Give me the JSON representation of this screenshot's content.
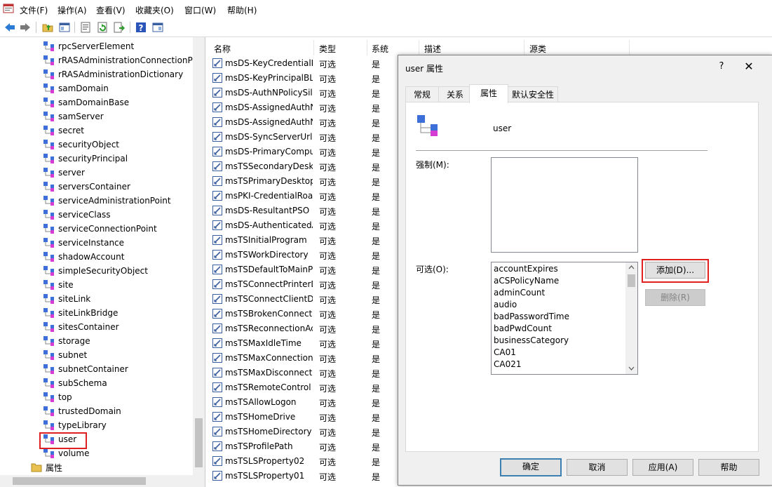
{
  "menu": [
    "文件(F)",
    "操作(A)",
    "查看(V)",
    "收藏夹(O)",
    "窗口(W)",
    "帮助(H)"
  ],
  "toolbar": {
    "icons": [
      "back-arrow-icon",
      "forward-arrow-icon",
      "up-folder-icon",
      "show-hide-tree-icon",
      "properties-icon",
      "refresh-icon",
      "export-list-icon",
      "help-icon",
      "console-icon"
    ]
  },
  "tree": {
    "items": [
      "rpcServerElement",
      "rRASAdministrationConnectionPc",
      "rRASAdministrationDictionary",
      "samDomain",
      "samDomainBase",
      "samServer",
      "secret",
      "securityObject",
      "securityPrincipal",
      "server",
      "serversContainer",
      "serviceAdministrationPoint",
      "serviceClass",
      "serviceConnectionPoint",
      "serviceInstance",
      "shadowAccount",
      "simpleSecurityObject",
      "site",
      "siteLink",
      "siteLinkBridge",
      "sitesContainer",
      "storage",
      "subnet",
      "subnetContainer",
      "subSchema",
      "top",
      "trustedDomain",
      "typeLibrary",
      "user",
      "volume"
    ],
    "selected_index": 28,
    "folder_label": "属性"
  },
  "list": {
    "columns": [
      "名称",
      "类型",
      "系统",
      "描述",
      "源类"
    ],
    "rows": [
      {
        "name": "msDS-KeyCredentialLink",
        "type": "可选",
        "sys": "是"
      },
      {
        "name": "msDS-KeyPrincipalBL",
        "type": "可选",
        "sys": "是"
      },
      {
        "name": "msDS-AuthNPolicySiloMembersBL",
        "type": "可选",
        "sys": "是"
      },
      {
        "name": "msDS-AssignedAuthNPolicySilo",
        "type": "可选",
        "sys": "是"
      },
      {
        "name": "msDS-AssignedAuthNPolicy",
        "type": "可选",
        "sys": "是"
      },
      {
        "name": "msDS-SyncServerUrl",
        "type": "可选",
        "sys": "是"
      },
      {
        "name": "msDS-PrimaryComputer",
        "type": "可选",
        "sys": "是"
      },
      {
        "name": "msTSSecondaryDesktops",
        "type": "可选",
        "sys": "是"
      },
      {
        "name": "msTSPrimaryDesktop",
        "type": "可选",
        "sys": "是"
      },
      {
        "name": "msPKI-CredentialRoamingTokens",
        "type": "可选",
        "sys": "是"
      },
      {
        "name": "msDS-ResultantPSO",
        "type": "可选",
        "sys": "是"
      },
      {
        "name": "msDS-AuthenticatedAtDC",
        "type": "可选",
        "sys": "是"
      },
      {
        "name": "msTSInitialProgram",
        "type": "可选",
        "sys": "是"
      },
      {
        "name": "msTSWorkDirectory",
        "type": "可选",
        "sys": "是"
      },
      {
        "name": "msTSDefaultToMainPrinter",
        "type": "可选",
        "sys": "是"
      },
      {
        "name": "msTSConnectPrinterDrives",
        "type": "可选",
        "sys": "是"
      },
      {
        "name": "msTSConnectClientDrives",
        "type": "可选",
        "sys": "是"
      },
      {
        "name": "msTSBrokenConnectionAction",
        "type": "可选",
        "sys": "是"
      },
      {
        "name": "msTSReconnectionAction",
        "type": "可选",
        "sys": "是"
      },
      {
        "name": "msTSMaxIdleTime",
        "type": "可选",
        "sys": "是"
      },
      {
        "name": "msTSMaxConnectionTime",
        "type": "可选",
        "sys": "是"
      },
      {
        "name": "msTSMaxDisconnectionTime",
        "type": "可选",
        "sys": "是"
      },
      {
        "name": "msTSRemoteControl",
        "type": "可选",
        "sys": "是"
      },
      {
        "name": "msTSAllowLogon",
        "type": "可选",
        "sys": "是"
      },
      {
        "name": "msTSHomeDrive",
        "type": "可选",
        "sys": "是"
      },
      {
        "name": "msTSHomeDirectory",
        "type": "可选",
        "sys": "是"
      },
      {
        "name": "msTSProfilePath",
        "type": "可选",
        "sys": "是"
      },
      {
        "name": "msTSLSProperty02",
        "type": "可选",
        "sys": "是"
      },
      {
        "name": "msTSLSProperty01",
        "type": "可选",
        "sys": "是"
      }
    ]
  },
  "dialog": {
    "title": "user 属性",
    "help": "?",
    "close": "✕",
    "tabs": [
      "常规",
      "关系",
      "属性",
      "默认安全性"
    ],
    "active_tab": 2,
    "class_name": "user",
    "mandatory_label": "强制(M):",
    "optional_label": "可选(O):",
    "optional_items": [
      "accountExpires",
      "aCSPolicyName",
      "adminCount",
      "audio",
      "badPasswordTime",
      "badPwdCount",
      "businessCategory",
      "CA01",
      "CA021"
    ],
    "add_button": "添加(D)...",
    "remove_button": "删除(R)",
    "ok_button": "确定",
    "cancel_button": "取消",
    "apply_button": "应用(A)",
    "help_button": "帮助"
  },
  "colors": {
    "highlight": "#e02020",
    "icon_blue": "#3c6fd8",
    "icon_magenta": "#d43cd4"
  }
}
